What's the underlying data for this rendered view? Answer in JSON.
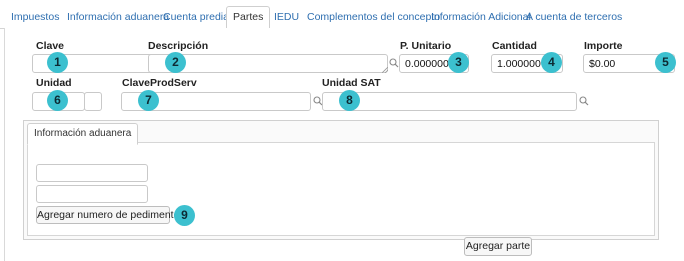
{
  "tabs": [
    {
      "label": "Impuestos"
    },
    {
      "label": "Información aduanera"
    },
    {
      "label": "Cuenta predial"
    },
    {
      "label": "Partes"
    },
    {
      "label": "IEDU"
    },
    {
      "label": "Complementos del concepto"
    },
    {
      "label": "Información Adicional"
    },
    {
      "label": "A cuenta de terceros"
    }
  ],
  "active_tab": "Partes",
  "form": {
    "clave": {
      "label": "Clave",
      "value": "",
      "badge": "1"
    },
    "descripcion": {
      "label": "Descripción",
      "value": "",
      "badge": "2"
    },
    "p_unitario": {
      "label": "P. Unitario",
      "value": "0.000000",
      "badge": "3"
    },
    "cantidad": {
      "label": "Cantidad",
      "value": "1.000000",
      "badge": "4"
    },
    "importe": {
      "label": "Importe",
      "value": "$0.00",
      "badge": "5"
    },
    "unidad": {
      "label": "Unidad",
      "value": "",
      "badge": "6"
    },
    "clave_prod_serv": {
      "label": "ClaveProdServ",
      "value": "",
      "badge": "7"
    },
    "unidad_sat": {
      "label": "Unidad SAT",
      "value": "",
      "badge": "8"
    }
  },
  "aduanera": {
    "tab_label": "Información aduanera",
    "field1": "",
    "field2": "",
    "add_button": "Agregar numero de pedimento",
    "badge": "9"
  },
  "add_part_button": "Agregar parte",
  "colors": {
    "accent": "#3cc0cf",
    "link": "#2f6fb0"
  },
  "icons": {
    "lookup": "search-icon",
    "resize": "resize-handle-icon"
  }
}
